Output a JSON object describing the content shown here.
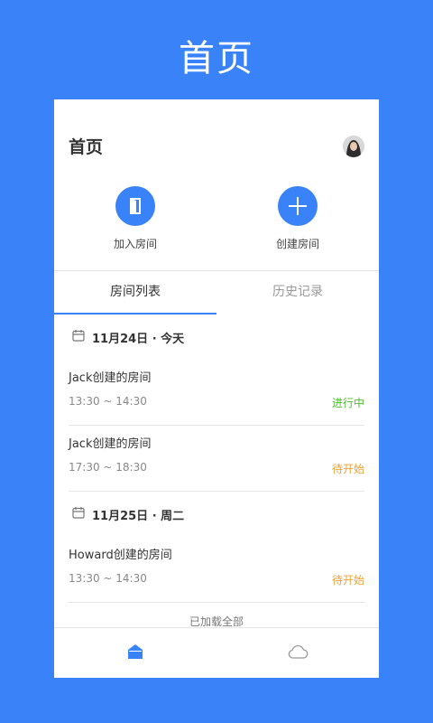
{
  "outer_title": "首页",
  "header": {
    "title": "首页"
  },
  "actions": [
    {
      "label": "加入房间",
      "icon": "door-icon"
    },
    {
      "label": "创建房间",
      "icon": "plus-icon"
    }
  ],
  "tabs": [
    {
      "label": "房间列表",
      "active": true
    },
    {
      "label": "历史记录",
      "active": false
    }
  ],
  "groups": [
    {
      "date": "11月24日 · 今天",
      "rooms": [
        {
          "name": "Jack创建的房间",
          "time": "13:30 ~ 14:30",
          "status": "进行中",
          "status_color": "#4cbf2a"
        },
        {
          "name": "Jack创建的房间",
          "time": "17:30 ~ 18:30",
          "status": "待开始",
          "status_color": "#f0a030"
        }
      ]
    },
    {
      "date": "11月25日 · 周二",
      "rooms": [
        {
          "name": "Howard创建的房间",
          "time": "13:30 ~ 14:30",
          "status": "待开始",
          "status_color": "#f0a030"
        }
      ]
    }
  ],
  "loaded_text": "已加载全部",
  "bottom_nav": [
    {
      "icon": "home-icon",
      "active": true
    },
    {
      "icon": "cloud-icon",
      "active": false
    }
  ],
  "colors": {
    "accent": "#3a82f7",
    "ongoing": "#4cbf2a",
    "pending": "#f0a030"
  }
}
